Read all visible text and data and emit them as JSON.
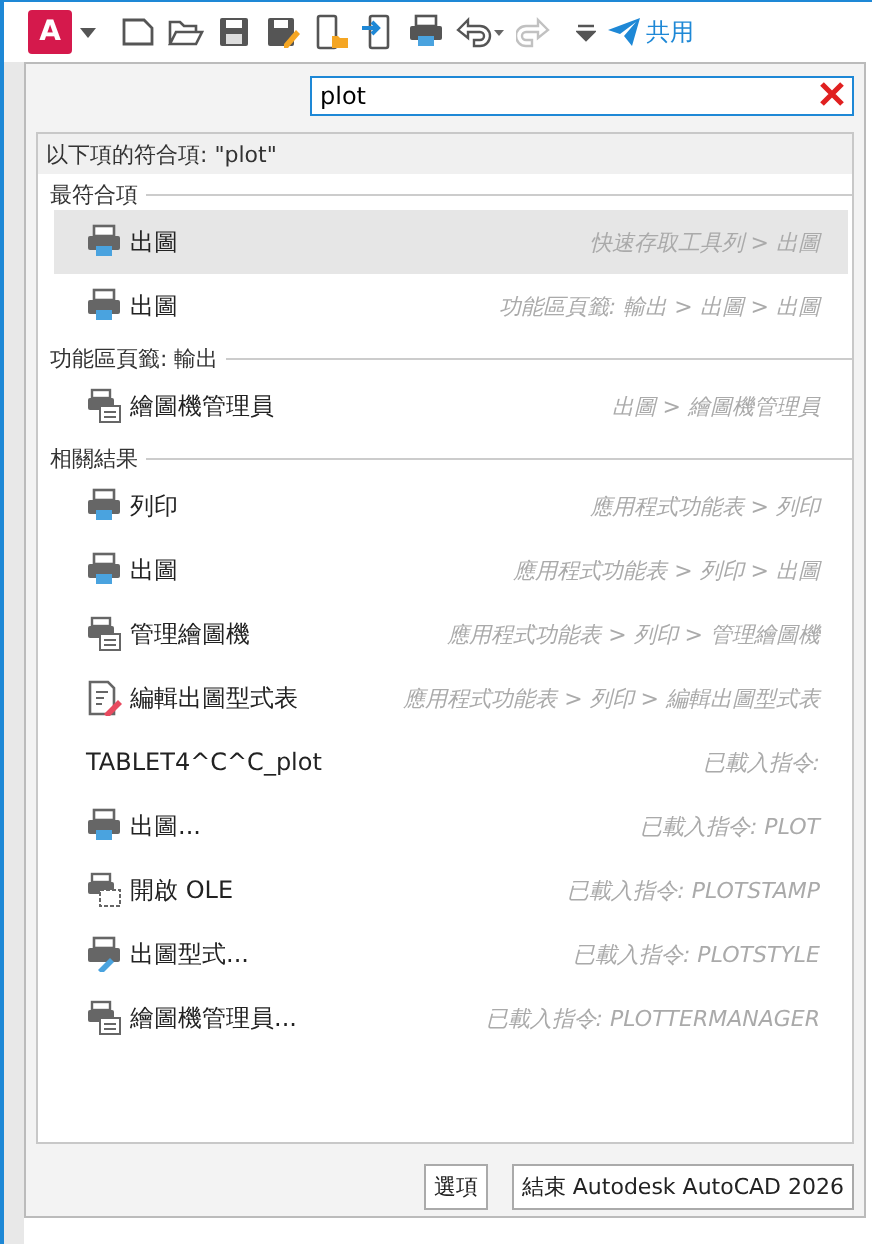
{
  "toolbar": {
    "logo": "A",
    "items": [
      {
        "kind": "new",
        "disabled": false
      },
      {
        "kind": "open",
        "disabled": false
      },
      {
        "kind": "save",
        "disabled": false
      },
      {
        "kind": "saveas",
        "disabled": false
      },
      {
        "kind": "openweb",
        "disabled": false
      },
      {
        "kind": "saveweb",
        "disabled": false
      },
      {
        "kind": "print",
        "disabled": false
      },
      {
        "kind": "undo",
        "disabled": false
      },
      {
        "kind": "redo",
        "disabled": true
      },
      {
        "kind": "more",
        "disabled": false
      }
    ],
    "share": "共用"
  },
  "search": {
    "value": "plot"
  },
  "results": {
    "header": "以下項的符合項: \"plot\"",
    "sections": [
      {
        "title": "最符合項",
        "rows": [
          {
            "kind": "printer",
            "label": "出圖",
            "path": "快速存取工具列 > 出圖",
            "selected": true
          },
          {
            "kind": "printer",
            "label": "出圖",
            "path": "功能區頁籤: 輸出 > 出圖 > 出圖",
            "selected": false
          }
        ]
      },
      {
        "title": "功能區頁籤: 輸出",
        "rows": [
          {
            "kind": "plotter",
            "label": "繪圖機管理員",
            "path": "出圖 > 繪圖機管理員",
            "selected": false
          }
        ]
      },
      {
        "title": "相關結果",
        "rows": [
          {
            "kind": "printer",
            "label": "列印",
            "path": "應用程式功能表 > 列印",
            "selected": false
          },
          {
            "kind": "printer",
            "label": "出圖",
            "path": "應用程式功能表 > 列印 > 出圖",
            "selected": false
          },
          {
            "kind": "plotter",
            "label": "管理繪圖機",
            "path": "應用程式功能表 > 列印 > 管理繪圖機",
            "selected": false
          },
          {
            "kind": "edit",
            "label": "編輯出圖型式表",
            "path": "應用程式功能表 > 列印 > 編輯出圖型式表",
            "selected": false
          },
          {
            "kind": "text",
            "label": "TABLET4^C^C_plot",
            "path": "已載入指令:",
            "selected": false
          },
          {
            "kind": "printer",
            "label": "出圖...",
            "path": "已載入指令: PLOT",
            "selected": false
          },
          {
            "kind": "stamp",
            "label": "開啟 OLE",
            "path": "已載入指令: PLOTSTAMP",
            "selected": false
          },
          {
            "kind": "style",
            "label": "出圖型式...",
            "path": "已載入指令: PLOTSTYLE",
            "selected": false
          },
          {
            "kind": "plotter",
            "label": "繪圖機管理員...",
            "path": "已載入指令: PLOTTERMANAGER",
            "selected": false
          }
        ]
      }
    ]
  },
  "buttons": [
    "選項",
    "結束 Autodesk AutoCAD 2026"
  ]
}
